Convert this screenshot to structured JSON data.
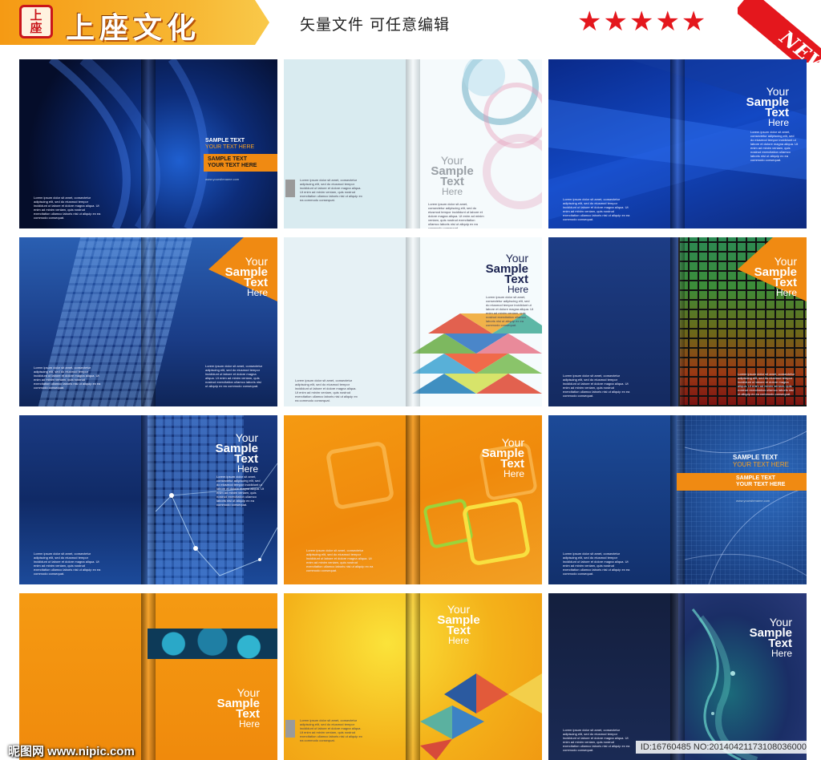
{
  "header": {
    "seal_text": [
      "上",
      "座"
    ],
    "brand_name": "上座文化",
    "tagline": "矢量文件    可任意编辑",
    "rating_stars": "★★★★★",
    "ribbon_label": "NEW"
  },
  "covers": {
    "sample_text": "SAMPLE TEXT",
    "your_text_here": "YOUR TEXT HERE",
    "your": "Your",
    "sample": "Sample",
    "text": "Text",
    "here": "Here",
    "website": "www.yoursitename.com",
    "lorem": "Lorem ipsum dolor sit amet, consectetur adipiscing elit, sed do eiusmod tempor incididunt ut labore et dolore magna aliqua. Ut enim ad minim veniam, quis nostrud exercitation ullamco laboris nisi ut aliquip ex ea commodo consequat."
  },
  "footer": {
    "site": "昵图网 www.nipic.com",
    "image_id": "ID:16760485 NO:20140421173108036000"
  },
  "colors": {
    "navy": "#0b1e4f",
    "blue": "#1546a3",
    "orange": "#f08a12",
    "yellow": "#f6c51a",
    "brand_red": "#e4171d"
  }
}
